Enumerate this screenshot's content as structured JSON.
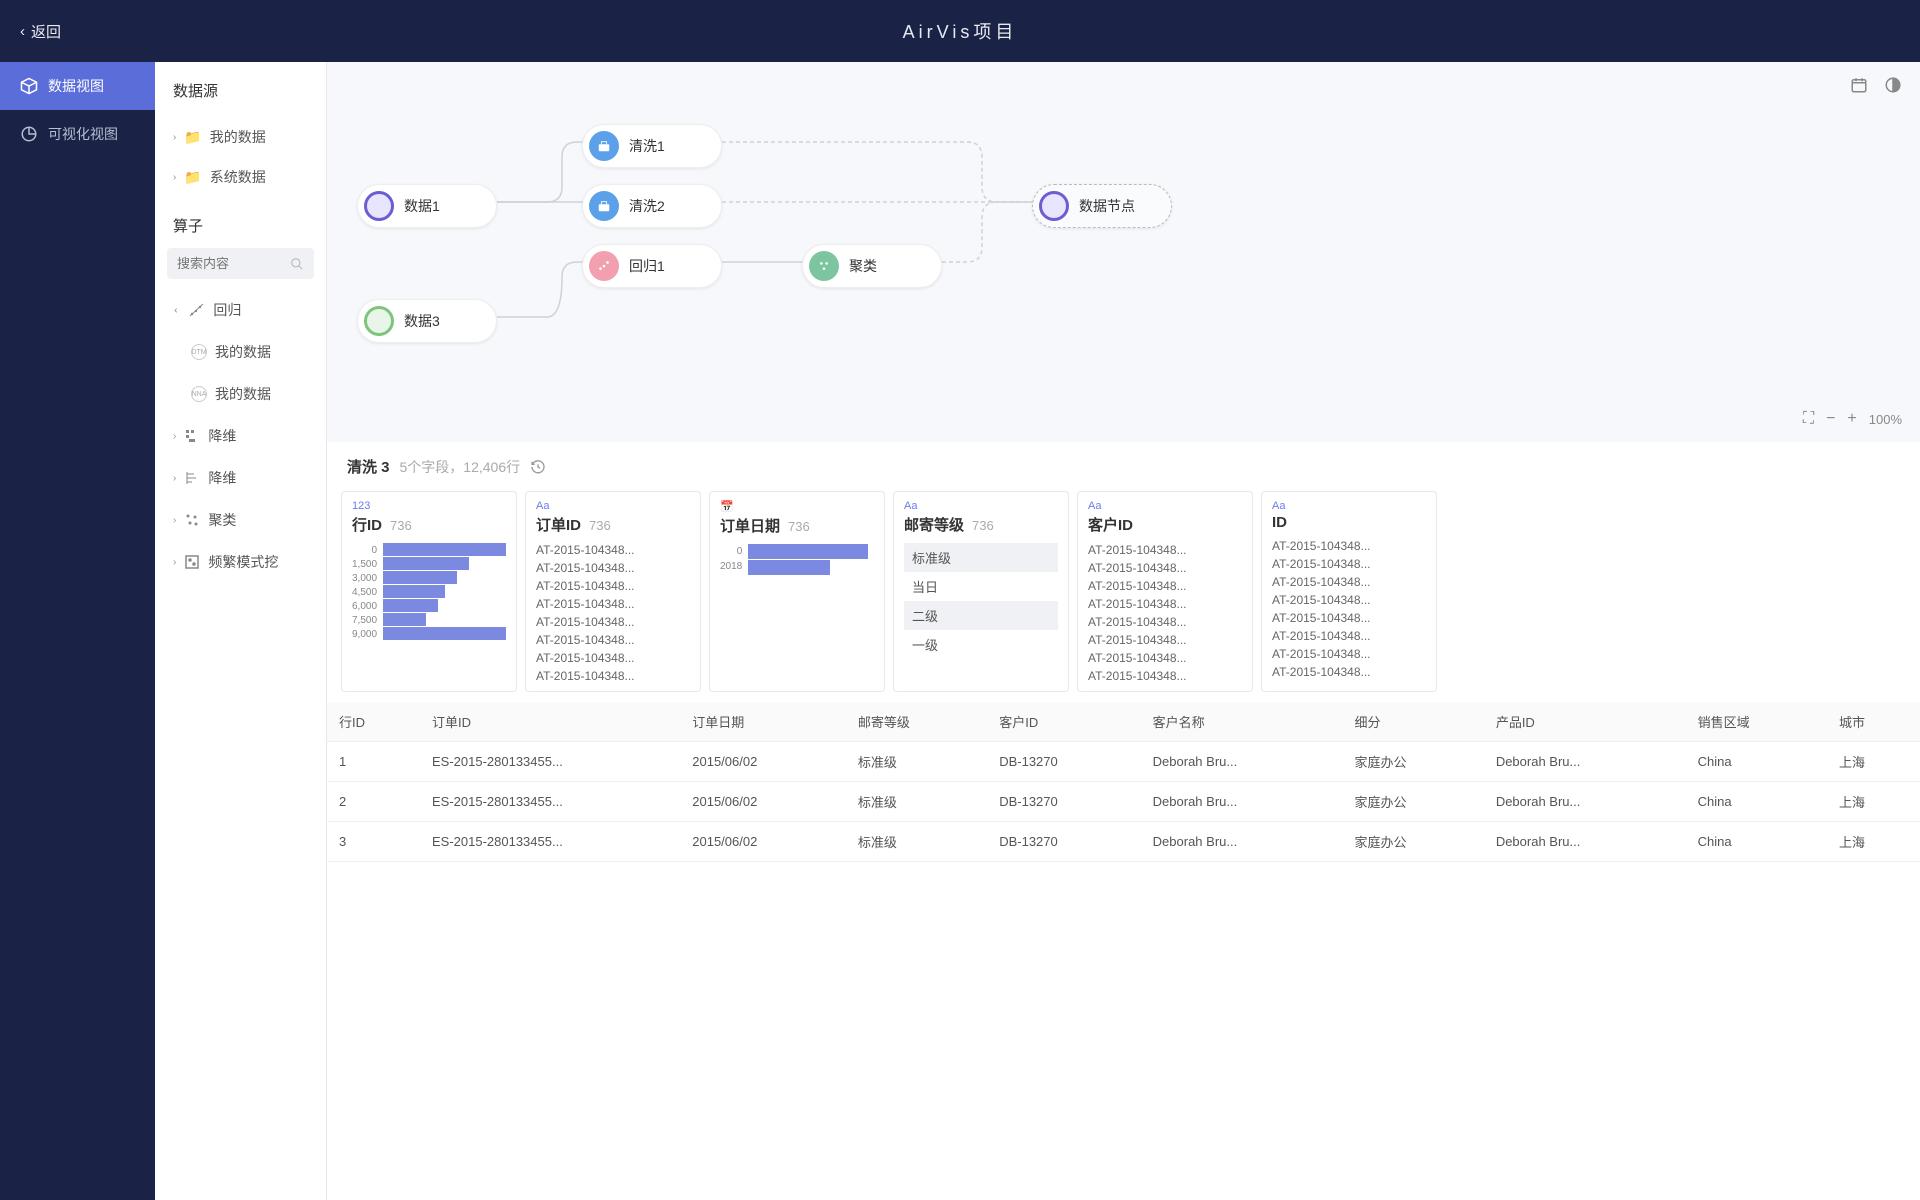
{
  "header": {
    "back": "返回",
    "title": "AirVis项目"
  },
  "nav": [
    {
      "label": "数据视图",
      "active": true
    },
    {
      "label": "可视化视图",
      "active": false
    }
  ],
  "sidebar": {
    "sources_title": "数据源",
    "sources": [
      {
        "label": "我的数据"
      },
      {
        "label": "系统数据"
      }
    ],
    "operators_title": "算子",
    "search_placeholder": "搜索内容",
    "operators": [
      {
        "label": "回归",
        "expanded": true,
        "children": [
          {
            "label": "我的数据"
          },
          {
            "label": "我的数据"
          }
        ]
      },
      {
        "label": "降维"
      },
      {
        "label": "降维"
      },
      {
        "label": "聚类"
      },
      {
        "label": "频繁模式挖"
      }
    ]
  },
  "canvas": {
    "nodes": {
      "data1": "数据1",
      "data3": "数据3",
      "clean1": "清洗1",
      "clean2": "清洗2",
      "reg1": "回归1",
      "cluster": "聚类",
      "endpoint": "数据节点"
    },
    "zoom": "100%"
  },
  "panel": {
    "title": "清洗 3",
    "meta": "5个字段，12,406行",
    "cards": [
      {
        "type": "123",
        "name": "行ID",
        "count": "736"
      },
      {
        "type": "Aa",
        "name": "订单ID",
        "count": "736"
      },
      {
        "type": "📅",
        "name": "订单日期",
        "count": "736"
      },
      {
        "type": "Aa",
        "name": "邮寄等级",
        "count": "736"
      },
      {
        "type": "Aa",
        "name": "客户ID",
        "count": ""
      },
      {
        "type": "Aa",
        "name": "ID",
        "count": ""
      }
    ],
    "row_id_labels": [
      "0",
      "1,500",
      "3,000",
      "4,500",
      "6,000",
      "7,500",
      "9,000"
    ],
    "date_labels": [
      "0",
      "2018"
    ],
    "order_id_list": [
      "AT-2015-104348...",
      "AT-2015-104348...",
      "AT-2015-104348...",
      "AT-2015-104348...",
      "AT-2015-104348...",
      "AT-2015-104348...",
      "AT-2015-104348...",
      "AT-2015-104348..."
    ],
    "ship_levels": [
      "标准级",
      "当日",
      "二级",
      "一级"
    ],
    "customer_list": [
      "AT-2015-104348...",
      "AT-2015-104348...",
      "AT-2015-104348...",
      "AT-2015-104348...",
      "AT-2015-104348...",
      "AT-2015-104348...",
      "AT-2015-104348...",
      "AT-2015-104348..."
    ]
  },
  "chart_data": [
    {
      "type": "bar",
      "title": "行ID",
      "orientation": "horizontal",
      "categories": [
        "0",
        "1,500",
        "3,000",
        "4,500",
        "6,000",
        "7,500",
        "9,000"
      ],
      "values": [
        100,
        70,
        60,
        50,
        45,
        35,
        100
      ],
      "xlabel": "",
      "ylabel": ""
    },
    {
      "type": "bar",
      "title": "订单日期",
      "orientation": "horizontal",
      "categories": [
        "0",
        "2018"
      ],
      "values": [
        95,
        65
      ],
      "xlabel": "",
      "ylabel": ""
    }
  ],
  "table": {
    "headers": [
      "行ID",
      "订单ID",
      "订单日期",
      "邮寄等级",
      "客户ID",
      "客户名称",
      "细分",
      "产品ID",
      "销售区域",
      "城市"
    ],
    "rows": [
      [
        "1",
        "ES-2015-280133455...",
        "2015/06/02",
        "标准级",
        "DB-13270",
        "Deborah Bru...",
        "家庭办公",
        "Deborah Bru...",
        "China",
        "上海"
      ],
      [
        "2",
        "ES-2015-280133455...",
        "2015/06/02",
        "标准级",
        "DB-13270",
        "Deborah Bru...",
        "家庭办公",
        "Deborah Bru...",
        "China",
        "上海"
      ],
      [
        "3",
        "ES-2015-280133455...",
        "2015/06/02",
        "标准级",
        "DB-13270",
        "Deborah Bru...",
        "家庭办公",
        "Deborah Bru...",
        "China",
        "上海"
      ]
    ]
  }
}
